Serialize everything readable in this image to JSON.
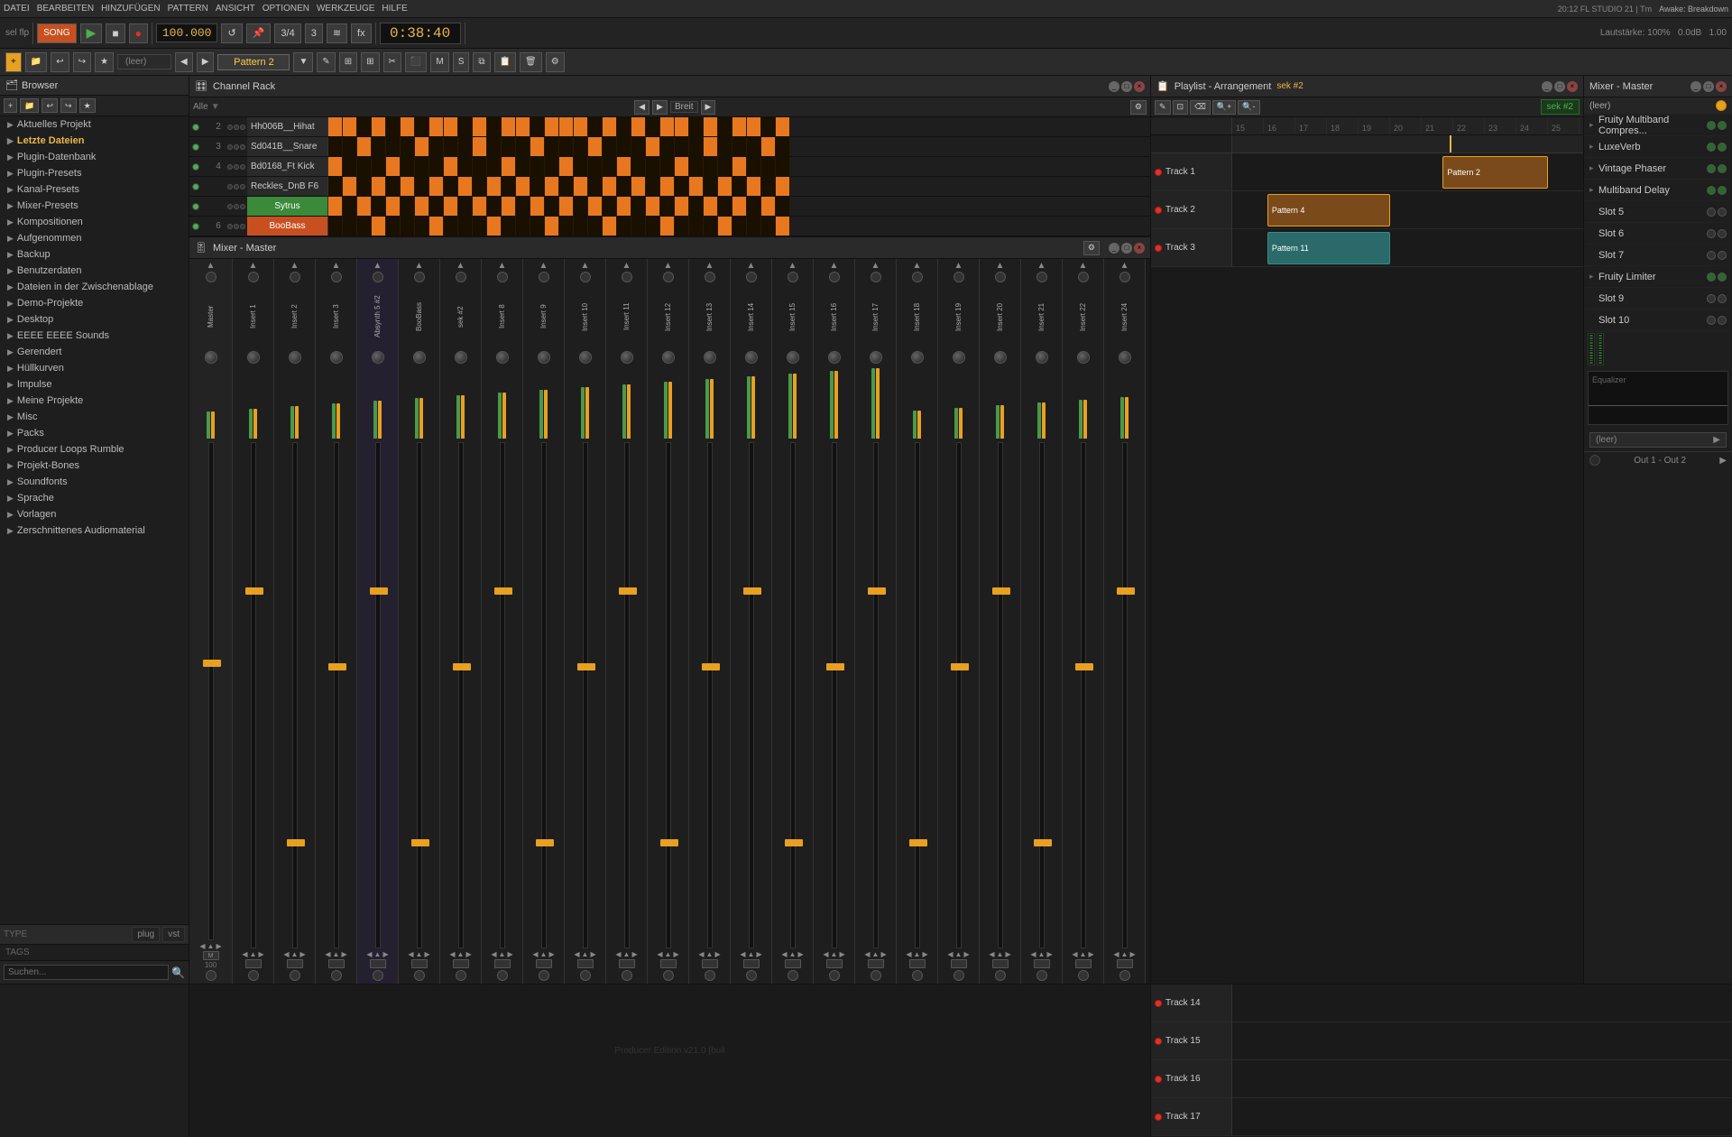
{
  "menu": {
    "items": [
      "DATEI",
      "BEARBEITEN",
      "HINZUFÜGEN",
      "PATTERN",
      "ANSICHT",
      "OPTIONEN",
      "WERKZEUGE",
      "HILFE"
    ]
  },
  "transport": {
    "bpm": "100.000",
    "time": "0:38:40",
    "pattern": "Pattern 2",
    "volume_label": "sel flp",
    "lautstärke": "Lautstärke: 100%",
    "pitch": "0.0dB",
    "steps": "1.00",
    "fl_info": "20:12  FL STUDIO 21 | Tm",
    "project_name": "Awake: Breakdown",
    "song_label": "SONG"
  },
  "browser": {
    "title": "Browser",
    "items": [
      {
        "label": "Aktuelles Projekt",
        "type": "folder"
      },
      {
        "label": "Letzte Dateien",
        "type": "folder",
        "active": true
      },
      {
        "label": "Plugin-Datenbank",
        "type": "folder"
      },
      {
        "label": "Plugin-Presets",
        "type": "folder"
      },
      {
        "label": "Kanal-Presets",
        "type": "folder"
      },
      {
        "label": "Mixer-Presets",
        "type": "folder"
      },
      {
        "label": "Kompositionen",
        "type": "folder"
      },
      {
        "label": "Aufgenommen",
        "type": "folder"
      },
      {
        "label": "Backup",
        "type": "folder"
      },
      {
        "label": "Benutzerdaten",
        "type": "folder"
      },
      {
        "label": "Dateien in der Zwischenablage",
        "type": "folder"
      },
      {
        "label": "Demo-Projekte",
        "type": "folder"
      },
      {
        "label": "Desktop",
        "type": "folder"
      },
      {
        "label": "EEEE EEEE Sounds",
        "type": "folder"
      },
      {
        "label": "Gerendert",
        "type": "folder"
      },
      {
        "label": "Hüllkurven",
        "type": "folder"
      },
      {
        "label": "Impulse",
        "type": "folder"
      },
      {
        "label": "Meine Projekte",
        "type": "folder"
      },
      {
        "label": "Misc",
        "type": "folder"
      },
      {
        "label": "Packs",
        "type": "folder"
      },
      {
        "label": "Producer Loops Rumble",
        "type": "folder"
      },
      {
        "label": "Projekt-Bones",
        "type": "folder"
      },
      {
        "label": "Soundfonts",
        "type": "folder"
      },
      {
        "label": "Sprache",
        "type": "folder"
      },
      {
        "label": "Vorlagen",
        "type": "folder"
      },
      {
        "label": "Zerschnittenes Audiomaterial",
        "type": "folder"
      }
    ],
    "search_placeholder": "Suchen...",
    "tags_label": "TAGS",
    "type_tabs": [
      "plug",
      "vst"
    ]
  },
  "channel_rack": {
    "title": "Channel Rack",
    "channels": [
      {
        "num": "2",
        "name": "Hh006B__Hihat",
        "on": true
      },
      {
        "num": "3",
        "name": "Sd041B__Snare",
        "on": true
      },
      {
        "num": "4",
        "name": "Bd0168_Ft Kick",
        "on": true
      },
      {
        "num": "",
        "name": "Reckles_DnB F6",
        "on": true
      },
      {
        "num": "",
        "name": "Sytrus",
        "on": true,
        "green": true
      },
      {
        "num": "6",
        "name": "BooBass",
        "on": true,
        "orange": true
      }
    ],
    "pattern_name": "Breit"
  },
  "mixer": {
    "title": "Mixer - Master",
    "channels": [
      {
        "name": "Master",
        "type": "master"
      },
      {
        "name": "Insert 1"
      },
      {
        "name": "Insert 2"
      },
      {
        "name": "Insert 3"
      },
      {
        "name": "Absynth 5 #2",
        "selected": true
      },
      {
        "name": "BooBass",
        "selected": false
      },
      {
        "name": "sek #2"
      },
      {
        "name": "Insert 8"
      },
      {
        "name": "Insert 9"
      },
      {
        "name": "Insert 10"
      },
      {
        "name": "Insert 11"
      },
      {
        "name": "Insert 12"
      },
      {
        "name": "Insert 13"
      },
      {
        "name": "Insert 14"
      },
      {
        "name": "Insert 15"
      },
      {
        "name": "Insert 16"
      },
      {
        "name": "Insert 17"
      },
      {
        "name": "Insert 18"
      },
      {
        "name": "Insert 19"
      },
      {
        "name": "Insert 20"
      },
      {
        "name": "Insert 21"
      },
      {
        "name": "Insert 22"
      },
      {
        "name": "Insert 24"
      }
    ]
  },
  "right_mixer": {
    "title": "Mixer - Master",
    "slots": [
      {
        "name": "Fruity Multiband Compres...",
        "expand": true
      },
      {
        "name": "LuxeVerb",
        "expand": true
      },
      {
        "name": "Vintage Phaser",
        "expand": true
      },
      {
        "name": "Multiband Delay",
        "expand": true
      },
      {
        "name": "Slot 5",
        "empty": true
      },
      {
        "name": "Slot 6",
        "empty": true
      },
      {
        "name": "Slot 7",
        "empty": true
      },
      {
        "name": "Fruity Limiter",
        "expand": true
      },
      {
        "name": "Slot 9",
        "empty": true
      },
      {
        "name": "Slot 10",
        "empty": true
      }
    ],
    "eq_label": "Equalizer",
    "send_empty": "(leer)",
    "output": "Out 1 - Out 2",
    "main_empty": "(leer)"
  },
  "playlist": {
    "title": "Playlist - Arrangement",
    "sek": "sek #2",
    "tracks": [
      {
        "name": "Track 1",
        "blocks": [
          {
            "label": "Pattern 2",
            "left": "60%",
            "width": "30%",
            "color": "orange"
          }
        ]
      },
      {
        "name": "Track 2",
        "blocks": [
          {
            "label": "Pattern 4",
            "left": "10%",
            "width": "35%",
            "color": "orange"
          }
        ]
      },
      {
        "name": "Track 3",
        "blocks": [
          {
            "label": "Pattern 11",
            "left": "10%",
            "width": "35%",
            "color": "teal"
          }
        ]
      }
    ],
    "bottom_tracks": [
      {
        "name": "Track 14"
      },
      {
        "name": "Track 15"
      },
      {
        "name": "Track 16"
      },
      {
        "name": "Track 17"
      }
    ],
    "ruler": [
      "15",
      "16",
      "17",
      "18",
      "19",
      "20",
      "21",
      "22",
      "23",
      "24",
      "25"
    ]
  },
  "footer": {
    "edition": "Producer Edition v21.0 [buil"
  }
}
